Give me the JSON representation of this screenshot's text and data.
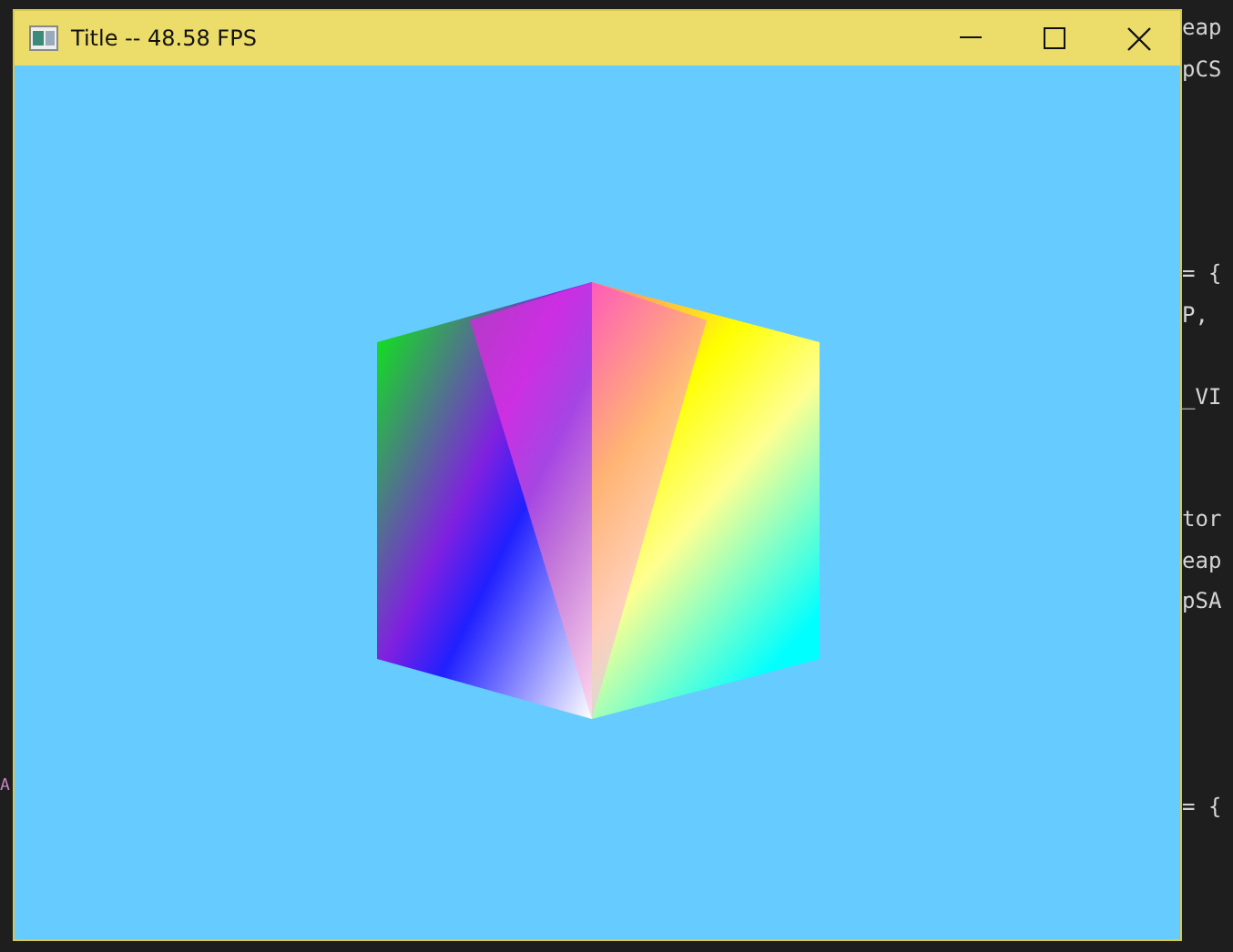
{
  "window": {
    "title": "Title -- 48.58 FPS"
  },
  "editor": {
    "left_fragment": "A",
    "right_blocks": [
      [
        "eap",
        "pCS"
      ],
      [
        "= {",
        "P,"
      ],
      [
        "_VI"
      ],
      [
        "tor",
        "eap",
        "pSA"
      ],
      [
        "= {"
      ]
    ]
  }
}
